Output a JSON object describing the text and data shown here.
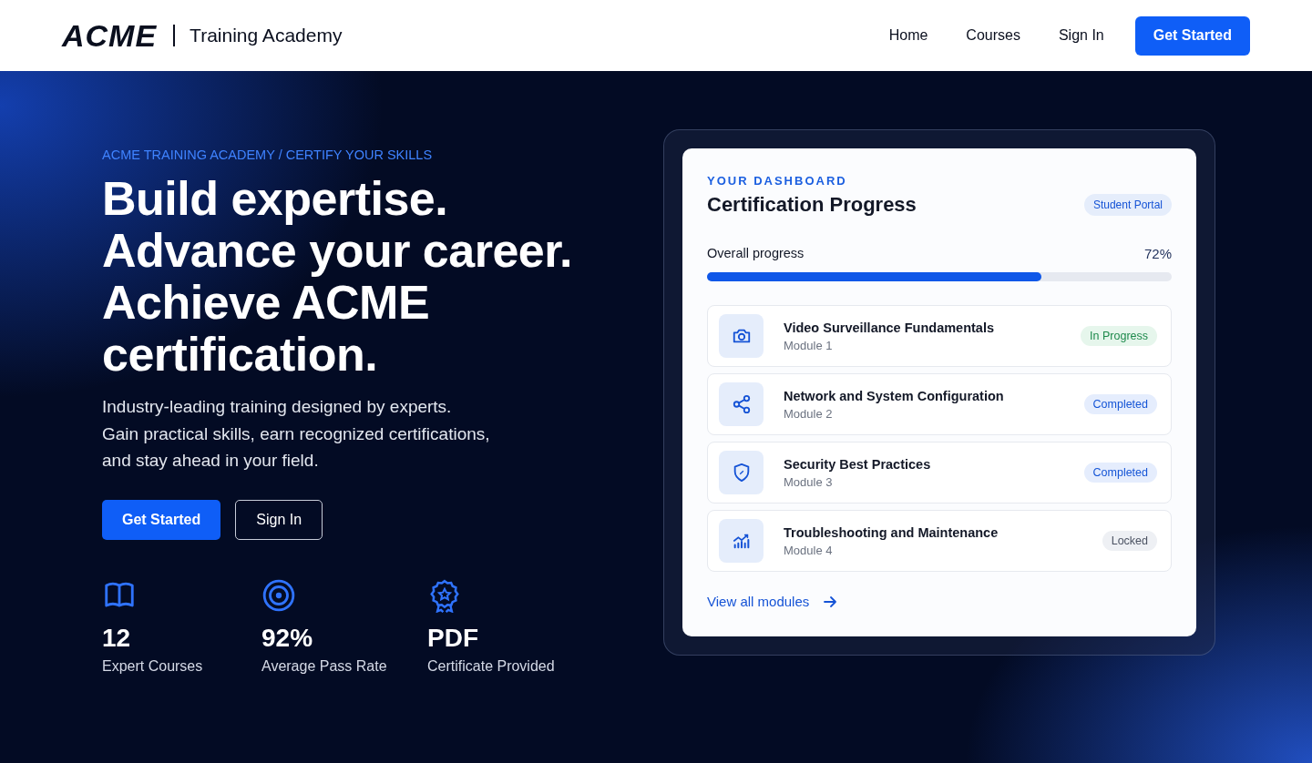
{
  "header": {
    "logo": "ACME",
    "subtitle": "Training Academy",
    "nav": [
      "Home",
      "Courses",
      "Sign In"
    ],
    "cta": "Get Started"
  },
  "hero": {
    "eyebrow": "ACME TRAINING ACADEMY / CERTIFY YOUR SKILLS",
    "headline": [
      "Build expertise.",
      "Advance your career.",
      "Achieve ACME",
      "certification."
    ],
    "description": [
      "Industry-leading training designed by experts.",
      "Gain practical skills, earn recognized certifications,",
      "and stay ahead in your field."
    ],
    "buttons": [
      {
        "label": "Get Started",
        "kind": "primary"
      },
      {
        "label": "Sign In",
        "kind": "secondary"
      }
    ],
    "stats": [
      {
        "value": "12",
        "label": "Expert Courses"
      },
      {
        "value": "92%",
        "label": "Average Pass Rate"
      },
      {
        "value": "PDF",
        "label": "Certificate Provided"
      }
    ]
  },
  "dashboard": {
    "eyebrow": "YOUR DASHBOARD",
    "title": "Certification Progress",
    "badge": "Student Portal",
    "progress": {
      "label": "Overall progress",
      "reading": "72%",
      "level": 0.72
    },
    "modules": [
      {
        "title": "Video Surveillance Fundamentals",
        "subtitle": "Module 1",
        "status": {
          "label": "In Progress",
          "kind": "in_progress"
        }
      },
      {
        "title": "Network and System Configuration",
        "subtitle": "Module 2",
        "status": {
          "label": "Completed",
          "kind": "completed"
        }
      },
      {
        "title": "Security Best Practices",
        "subtitle": "Module 3",
        "status": {
          "label": "Completed",
          "kind": "completed"
        }
      },
      {
        "title": "Troubleshooting and Maintenance",
        "subtitle": "Module 4",
        "status": {
          "label": "Locked",
          "kind": "locked"
        }
      }
    ],
    "link": "View all modules"
  }
}
